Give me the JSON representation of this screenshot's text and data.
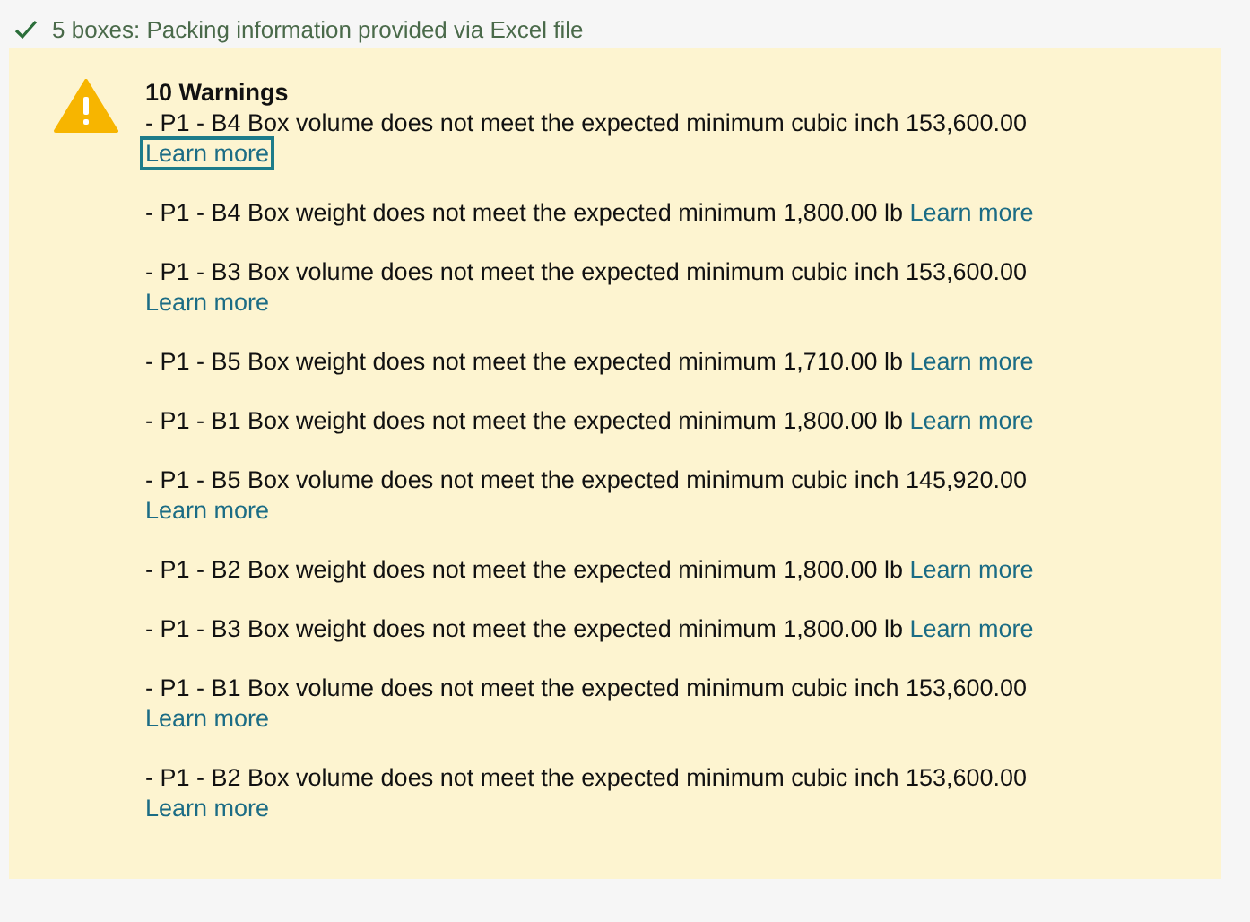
{
  "status": {
    "text": "5 boxes: Packing information provided via Excel file"
  },
  "alert": {
    "title": "10 Warnings",
    "warnings": [
      {
        "message": "- P1 - B4 Box volume does not meet the expected minimum cubic inch 153,600.00",
        "link": "Learn more",
        "focused": true
      },
      {
        "message": "- P1 - B4 Box weight does not meet the expected minimum 1,800.00 lb",
        "link": "Learn more",
        "focused": false
      },
      {
        "message": "- P1 - B3 Box volume does not meet the expected minimum cubic inch 153,600.00",
        "link": "Learn more",
        "focused": false
      },
      {
        "message": "- P1 - B5 Box weight does not meet the expected minimum 1,710.00 lb",
        "link": "Learn more",
        "focused": false
      },
      {
        "message": "- P1 - B1 Box weight does not meet the expected minimum 1,800.00 lb",
        "link": "Learn more",
        "focused": false
      },
      {
        "message": "- P1 - B5 Box volume does not meet the expected minimum cubic inch 145,920.00",
        "link": "Learn more",
        "focused": false
      },
      {
        "message": "- P1 - B2 Box weight does not meet the expected minimum 1,800.00 lb",
        "link": "Learn more",
        "focused": false
      },
      {
        "message": "- P1 - B3 Box weight does not meet the expected minimum 1,800.00 lb",
        "link": "Learn more",
        "focused": false
      },
      {
        "message": "- P1 - B1 Box volume does not meet the expected minimum cubic inch 153,600.00",
        "link": "Learn more",
        "focused": false
      },
      {
        "message": "- P1 - B2 Box volume does not meet the expected minimum cubic inch 153,600.00",
        "link": "Learn more",
        "focused": false
      }
    ]
  }
}
